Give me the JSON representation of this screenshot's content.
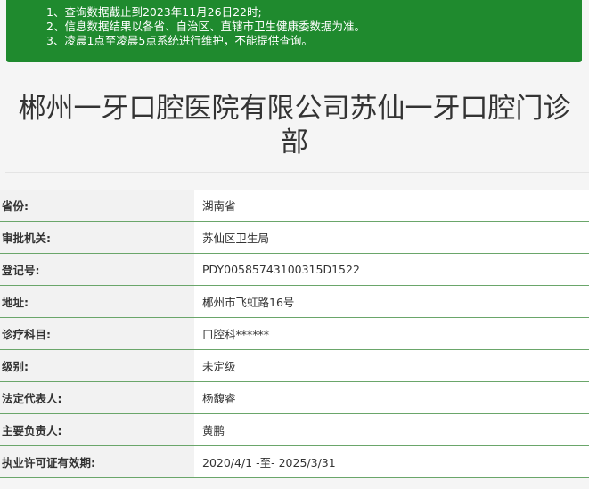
{
  "notice": {
    "lines": [
      "1、查询数据截止到2023年11月26日22时;",
      "2、信息数据结果以各省、自治区、直辖市卫生健康委数据为准。",
      "3、凌晨1点至凌晨5点系统进行维护，不能提供查询。"
    ]
  },
  "title_line1": "郴州一牙口腔医院有限公司苏仙一牙口腔门诊",
  "title_line2": "部",
  "rows": [
    {
      "label": "省份:",
      "value": "湖南省"
    },
    {
      "label": "审批机关:",
      "value": "苏仙区卫生局"
    },
    {
      "label": "登记号:",
      "value": "PDY00585743100315D1522"
    },
    {
      "label": "地址:",
      "value": "郴州市飞虹路16号"
    },
    {
      "label": "诊疗科目:",
      "value": "口腔科******"
    },
    {
      "label": "级别:",
      "value": "未定级"
    },
    {
      "label": "法定代表人:",
      "value": "杨馥睿"
    },
    {
      "label": "主要负责人:",
      "value": "黄鹏"
    },
    {
      "label": "执业许可证有效期:",
      "value": "2020/4/1 -至- 2025/3/31"
    }
  ]
}
